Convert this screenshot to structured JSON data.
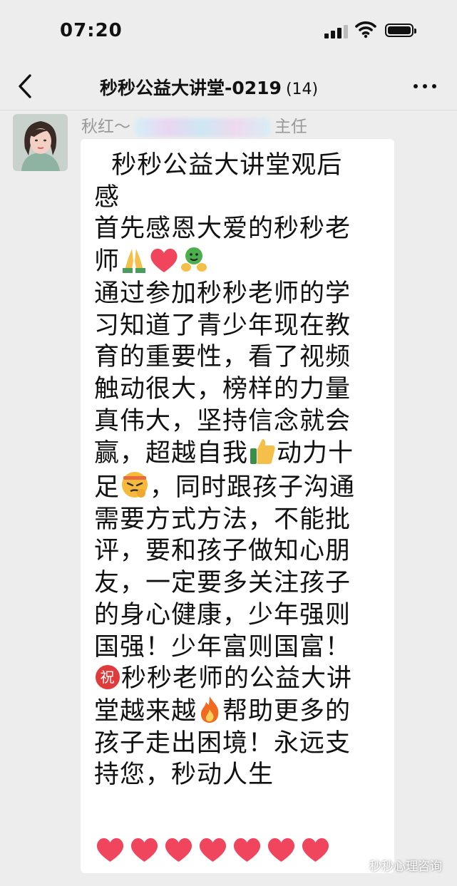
{
  "status_bar": {
    "time": "07:20",
    "icons": [
      "signal-icon",
      "wifi-icon",
      "battery-icon"
    ]
  },
  "header": {
    "title": "秒秒公益大讲堂-0219",
    "member_count": "(14)",
    "back_icon": "chevron-left-icon",
    "more_icon": "more-icon"
  },
  "message": {
    "sender_name_start": "秋红～",
    "sender_name_end": "主任",
    "lines": [
      "  秒秒公益大讲堂观后",
      "感",
      "首先感恩大爱的秒秒老",
      "师",
      "通过参加秒秒老师的学",
      "习知道了青少年现在教",
      "育的重要性，看了视频",
      "触动很大，榜样的力量",
      "真伟大，坚持信念就会",
      "赢，超越自我",
      "动力十",
      "足",
      "，同时跟孩子沟通",
      "需要方式方法，不能批",
      "评，要和孩子做知心朋",
      "友，一定要多关注孩子",
      "的身心健康，少年强则",
      "国强！少年富则国富！",
      "秒秒老师的公益大讲",
      "堂越来越",
      "帮助更多的",
      "孩子走出困境！永远支",
      "持您，秒动人生"
    ],
    "emoji": {
      "congrats_label": "祝",
      "heart_count": 7
    }
  },
  "watermark": {
    "text": "秒秒心理咨询"
  },
  "colors": {
    "background": "#ededed",
    "bubble": "#ffffff",
    "heart": "#f0455c",
    "sender": "#999999"
  }
}
